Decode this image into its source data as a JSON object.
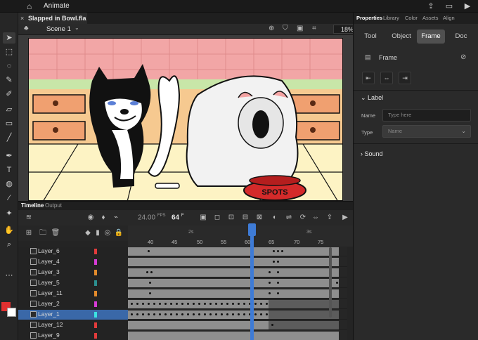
{
  "app": {
    "name": "Animate"
  },
  "document": {
    "tab_title": "Slapped in Bowl.fla",
    "close_glyph": "×"
  },
  "scene": {
    "label": "Scene 1",
    "zoom": "18%"
  },
  "timeline": {
    "tabs": [
      "Timeline",
      "Output"
    ],
    "fps": "24.00",
    "fps_unit": "FPS",
    "current_frame": "64",
    "frame_unit": "F",
    "ruler_numbers": [
      "40",
      "45",
      "50",
      "55",
      "60",
      "65",
      "70",
      "75"
    ],
    "ruler_seconds": [
      "2s",
      "3s"
    ],
    "layers": [
      {
        "name": "Layer_6",
        "color": "#e23b3b"
      },
      {
        "name": "Layer_4",
        "color": "#d63bd6"
      },
      {
        "name": "Layer_3",
        "color": "#e28a2b"
      },
      {
        "name": "Layer_5",
        "color": "#2b8f8f"
      },
      {
        "name": "Layer_11",
        "color": "#e28a2b"
      },
      {
        "name": "Layer_2",
        "color": "#d63bd6"
      },
      {
        "name": "Layer_1",
        "color": "#3be2e2",
        "selected": true
      },
      {
        "name": "Layer_12",
        "color": "#e23b3b"
      },
      {
        "name": "Layer_9",
        "color": "#e23b3b"
      }
    ]
  },
  "properties": {
    "tabs": [
      "Properties",
      "Library",
      "Color",
      "Assets",
      "Align"
    ],
    "active_tab": "Properties",
    "sub_tabs": [
      "Tool",
      "Object",
      "Frame",
      "Doc"
    ],
    "active_sub_tab": "Frame",
    "frame_header": "Frame",
    "label_section": "Label",
    "name_label": "Name",
    "name_placeholder": "Type here",
    "type_label": "Type",
    "type_value": "Name",
    "sound_section": "Sound"
  },
  "stage_text": {
    "bowl_label": "SPOTS"
  },
  "colors": {
    "accent": "#3e7bd6",
    "stroke": "#e03030",
    "fill": "#ffffff"
  }
}
